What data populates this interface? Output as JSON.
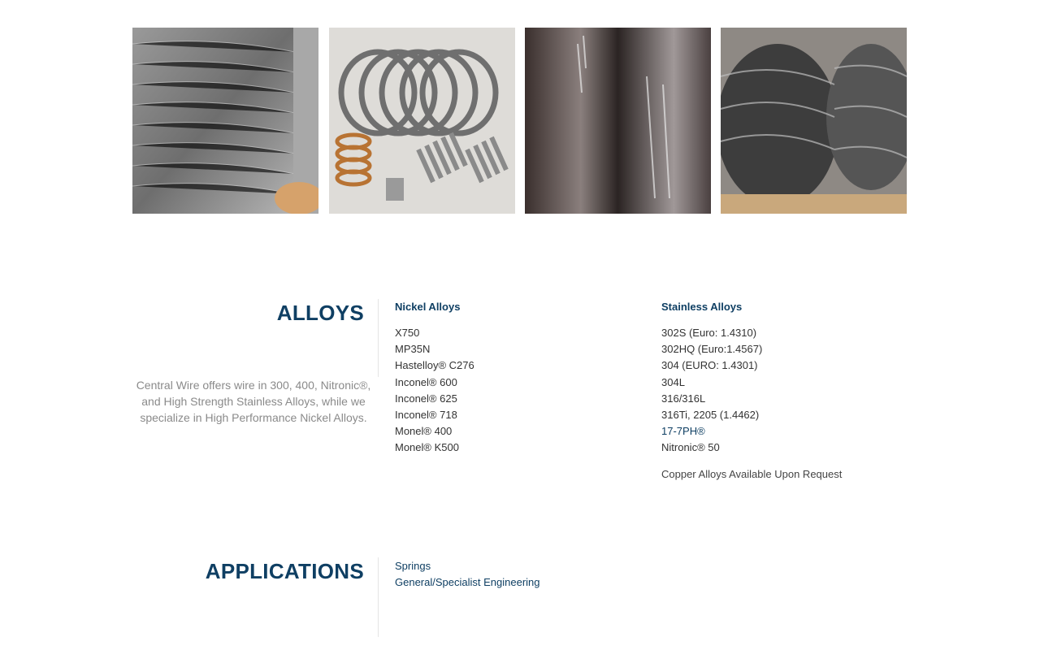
{
  "gallery": [
    {
      "label": "Coiled stainless wire spools"
    },
    {
      "label": "Springs and coiled components"
    },
    {
      "label": "Fine wire on spool"
    },
    {
      "label": "Wire coils on pallets"
    }
  ],
  "alloys": {
    "heading": "ALLOYS",
    "description": "Central Wire offers wire in 300, 400, Nitronic®, and High Strength Stainless Alloys, while we specialize in High Performance Nickel Alloys.",
    "nickel": {
      "title": "Nickel Alloys",
      "items": [
        "X750",
        "MP35N",
        "Hastelloy® C276",
        "Inconel® 600",
        "Inconel® 625",
        "Inconel® 718",
        "Monel® 400",
        "Monel® K500"
      ]
    },
    "stainless": {
      "title": "Stainless Alloys",
      "items": [
        "302S (Euro: 1.4310)",
        "302HQ (Euro:1.4567)",
        "304 (EURO: 1.4301)",
        "304L",
        "316/316L",
        "316Ti, 2205 (1.4462)",
        "17-7PH®",
        "Nitronic® 50"
      ],
      "note": "Copper Alloys Available Upon Request"
    }
  },
  "applications": {
    "heading": "APPLICATIONS",
    "links": [
      "Springs",
      "General/Specialist Engineering"
    ]
  },
  "colors": {
    "brand": "#0f3f63",
    "muted": "#8a8a8a",
    "text": "#333333"
  }
}
